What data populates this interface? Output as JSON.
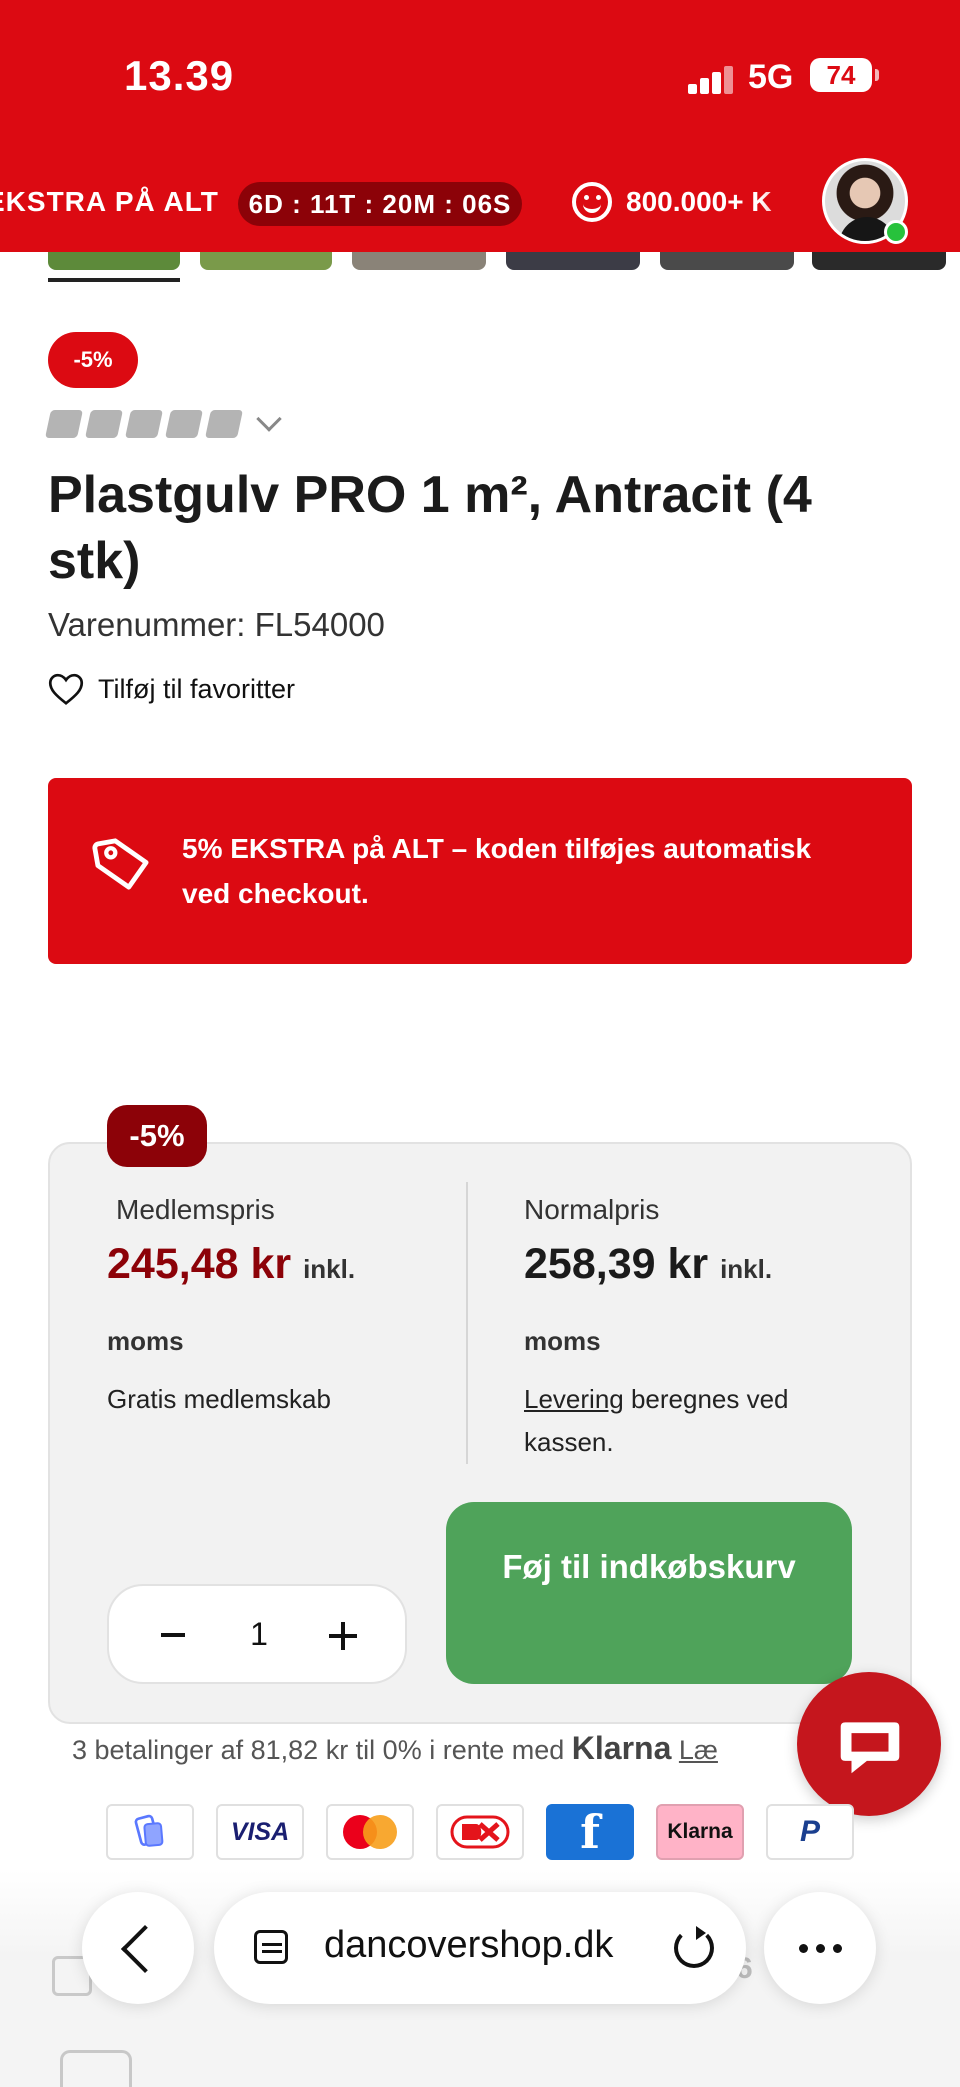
{
  "status_bar": {
    "time": "13.39",
    "network": "5G",
    "battery": "74"
  },
  "promo_header": {
    "campaign_text": "EKSTRA PÅ ALT",
    "countdown": "6D : 11T : 20M : 06S",
    "customers_text": "800.000+ K"
  },
  "product": {
    "discount_badge": "-5%",
    "title": "Plastgulv PRO 1 m², Antracit (4 stk)",
    "sku": "Varenummer: FL54000",
    "favorite_label": "Tilføj til favoritter"
  },
  "promo_banner": {
    "text": "5% EKSTRA på ALT – koden tilføjes automatisk ved checkout."
  },
  "pricing": {
    "badge": "-5%",
    "member": {
      "label": "Medlemspris",
      "price": "245,48 kr",
      "inkl": "inkl.",
      "moms": "moms",
      "note": "Gratis medlemskab"
    },
    "normal": {
      "label": "Normalpris",
      "price": "258,39 kr",
      "inkl": "inkl.",
      "moms": "moms",
      "delivery_link": "Levering",
      "delivery_rest": " beregnes ved kassen."
    },
    "quantity": "1",
    "add_to_cart": "Føj til indkøbskurv"
  },
  "klarna": {
    "text": "3 betalinger af 81,82 kr til 0% i rente med",
    "logo": "Klarna",
    "link": "Læ"
  },
  "payments": {
    "visa": "VISA",
    "klarna": "Klarna",
    "paypal": "P"
  },
  "browser": {
    "url": "dancovershop.dk",
    "ghost_count": "6"
  },
  "colors": {
    "brand_red": "#dc0a12",
    "dark_red": "#8c0208",
    "cart_green": "#4fa35a"
  }
}
